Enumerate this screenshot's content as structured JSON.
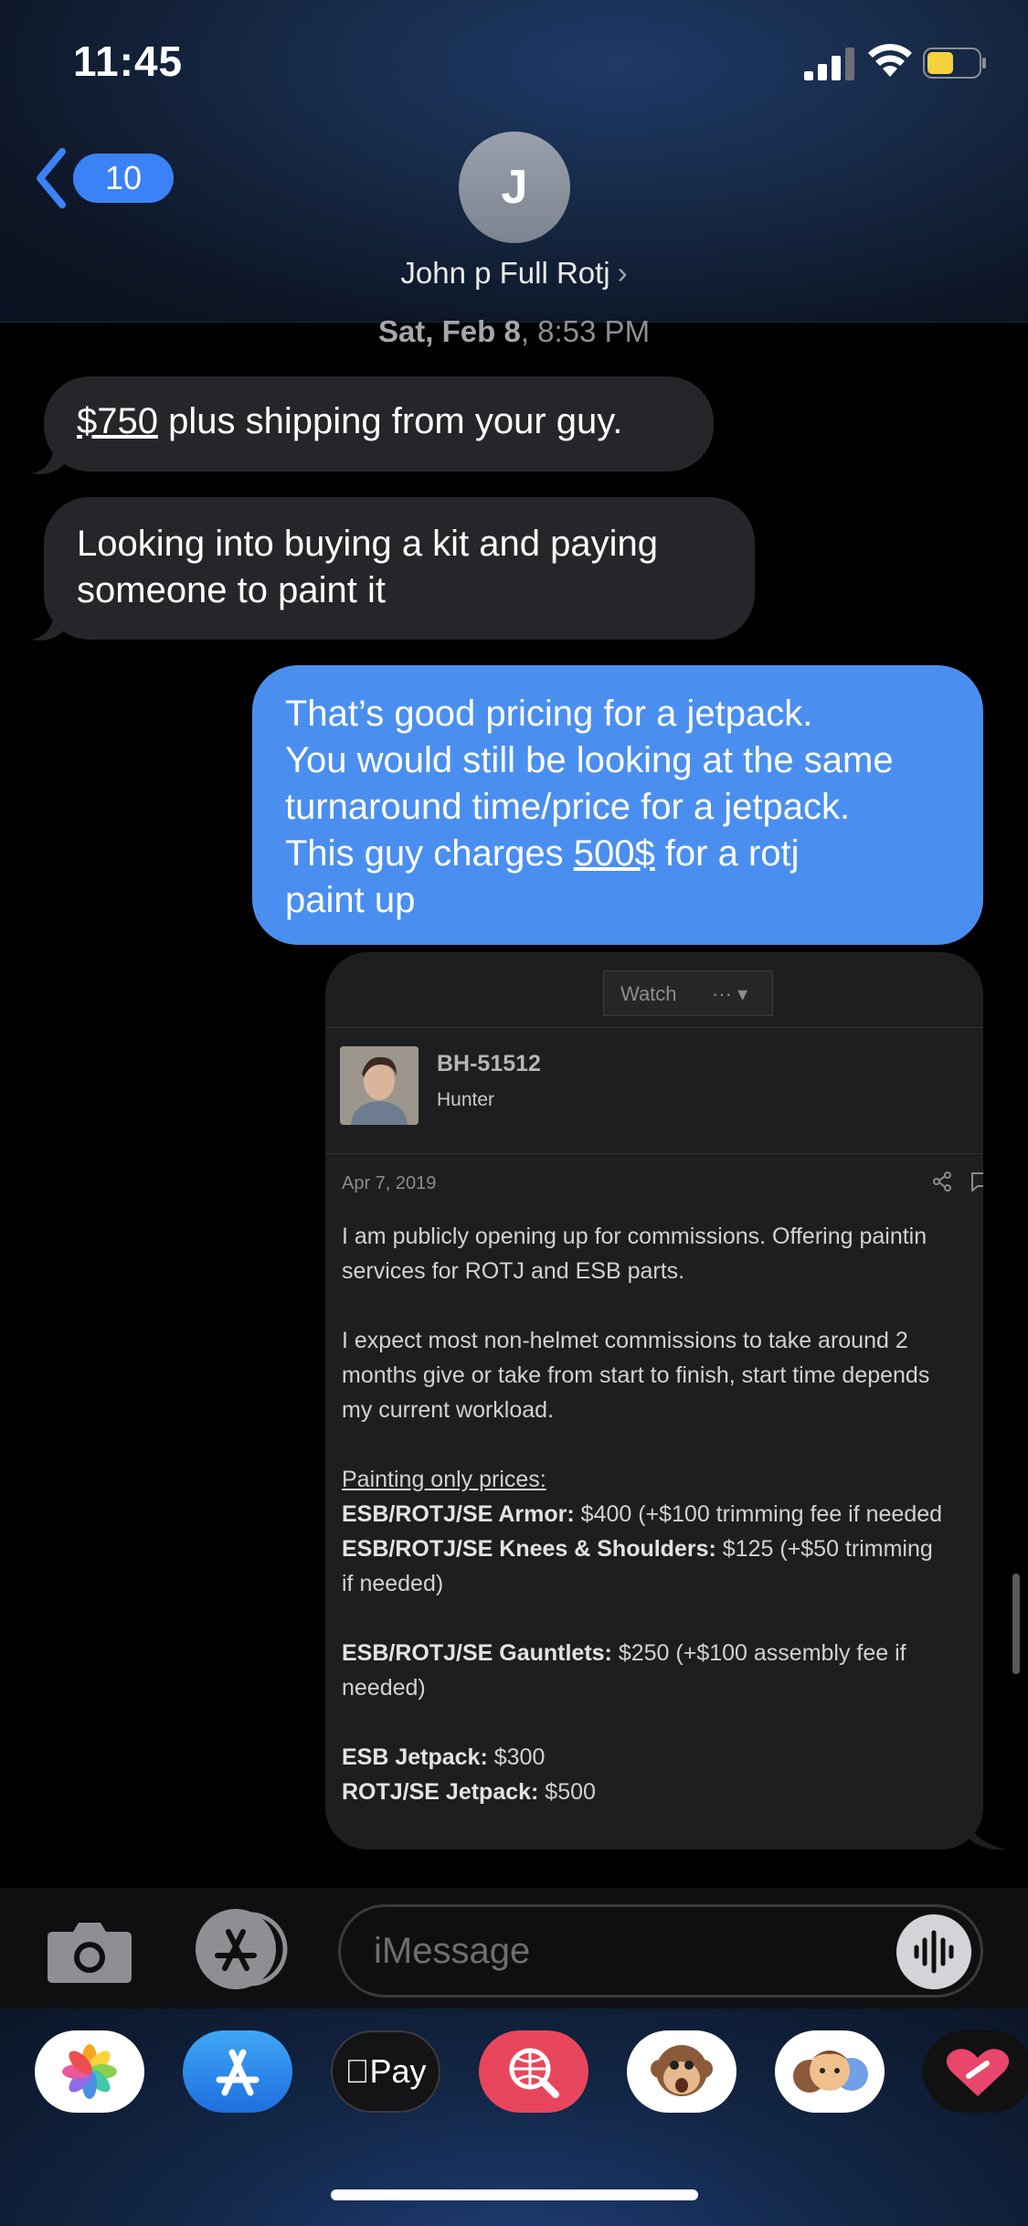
{
  "status": {
    "time": "11:45"
  },
  "nav": {
    "back_count": "10",
    "avatar_initial": "J",
    "contact_name": "John p Full Rotj"
  },
  "thread": {
    "date_day": "Sat, Feb 8",
    "date_time": ", 8:53 PM",
    "msg1_price": "$750",
    "msg1_rest": " plus shipping from your guy.",
    "msg2_line1": "Looking into buying a kit and paying",
    "msg2_line2": "someone to paint it",
    "msg3_line1": "That’s good pricing for a jetpack.",
    "msg3_line2": "You would still be looking at the same",
    "msg3_line3": "turnaround time/price for a jetpack.",
    "msg3_line4_pre": "This guy charges ",
    "msg3_line4_price": "500$",
    "msg3_line4_post": " for a rotj",
    "msg3_line5": "paint up"
  },
  "forum": {
    "watch_label": "Watch",
    "more_label": "···",
    "username": "BH-51512",
    "role": "Hunter",
    "post_date": "Apr 7, 2019",
    "p1a": "I am publicly opening up for commissions. Offering paintin",
    "p1b": "services for ROTJ and ESB parts.",
    "p2a": "I expect most non-helmet commissions to take around 2",
    "p2b": "months give or take from start to finish, start time depends",
    "p2c": "my current workload.",
    "prices_heading": "Painting only prices:",
    "armor_label": "ESB/ROTJ/SE Armor:",
    "armor_price": " $400 (+$100 trimming fee if needed",
    "knees_label": "ESB/ROTJ/SE Knees & Shoulders:",
    "knees_price": " $125 (+$50 trimming",
    "knees_cont": "if needed)",
    "gauntlets_label": "ESB/ROTJ/SE Gauntlets:",
    "gauntlets_price": " $250 (+$100 assembly fee if",
    "gauntlets_cont": "needed)",
    "esb_jetpack_label": "ESB Jetpack:",
    "esb_jetpack_price": " $300",
    "rotj_jetpack_label": "ROTJ/SE Jetpack:",
    "rotj_jetpack_price": " $500"
  },
  "composer": {
    "placeholder": "iMessage"
  },
  "colors": {
    "outgoing_bubble": "#4a8ff0",
    "incoming_bubble": "#26262a",
    "accent": "#3b82f6"
  },
  "apps": [
    "photos-app-icon",
    "app-store-app-icon",
    "apple-pay-app-icon",
    "search-images-app-icon",
    "monkey-animoji-app-icon",
    "memoji-app-icon",
    "heart-stickers-app-icon"
  ],
  "apple_pay_label": "Pay"
}
